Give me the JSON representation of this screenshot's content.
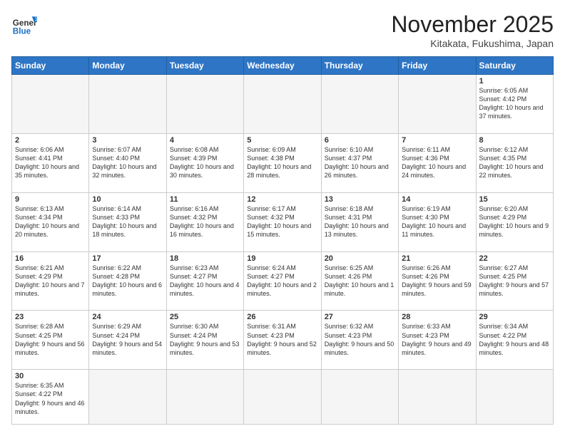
{
  "header": {
    "logo_general": "General",
    "logo_blue": "Blue",
    "month_title": "November 2025",
    "location": "Kitakata, Fukushima, Japan"
  },
  "weekdays": [
    "Sunday",
    "Monday",
    "Tuesday",
    "Wednesday",
    "Thursday",
    "Friday",
    "Saturday"
  ],
  "weeks": [
    [
      {
        "day": "",
        "empty": true
      },
      {
        "day": "",
        "empty": true
      },
      {
        "day": "",
        "empty": true
      },
      {
        "day": "",
        "empty": true
      },
      {
        "day": "",
        "empty": true
      },
      {
        "day": "",
        "empty": true
      },
      {
        "day": "1",
        "sunrise": "6:05 AM",
        "sunset": "4:42 PM",
        "daylight": "10 hours and 37 minutes."
      }
    ],
    [
      {
        "day": "2",
        "sunrise": "6:06 AM",
        "sunset": "4:41 PM",
        "daylight": "10 hours and 35 minutes."
      },
      {
        "day": "3",
        "sunrise": "6:07 AM",
        "sunset": "4:40 PM",
        "daylight": "10 hours and 32 minutes."
      },
      {
        "day": "4",
        "sunrise": "6:08 AM",
        "sunset": "4:39 PM",
        "daylight": "10 hours and 30 minutes."
      },
      {
        "day": "5",
        "sunrise": "6:09 AM",
        "sunset": "4:38 PM",
        "daylight": "10 hours and 28 minutes."
      },
      {
        "day": "6",
        "sunrise": "6:10 AM",
        "sunset": "4:37 PM",
        "daylight": "10 hours and 26 minutes."
      },
      {
        "day": "7",
        "sunrise": "6:11 AM",
        "sunset": "4:36 PM",
        "daylight": "10 hours and 24 minutes."
      },
      {
        "day": "8",
        "sunrise": "6:12 AM",
        "sunset": "4:35 PM",
        "daylight": "10 hours and 22 minutes."
      }
    ],
    [
      {
        "day": "9",
        "sunrise": "6:13 AM",
        "sunset": "4:34 PM",
        "daylight": "10 hours and 20 minutes."
      },
      {
        "day": "10",
        "sunrise": "6:14 AM",
        "sunset": "4:33 PM",
        "daylight": "10 hours and 18 minutes."
      },
      {
        "day": "11",
        "sunrise": "6:16 AM",
        "sunset": "4:32 PM",
        "daylight": "10 hours and 16 minutes."
      },
      {
        "day": "12",
        "sunrise": "6:17 AM",
        "sunset": "4:32 PM",
        "daylight": "10 hours and 15 minutes."
      },
      {
        "day": "13",
        "sunrise": "6:18 AM",
        "sunset": "4:31 PM",
        "daylight": "10 hours and 13 minutes."
      },
      {
        "day": "14",
        "sunrise": "6:19 AM",
        "sunset": "4:30 PM",
        "daylight": "10 hours and 11 minutes."
      },
      {
        "day": "15",
        "sunrise": "6:20 AM",
        "sunset": "4:29 PM",
        "daylight": "10 hours and 9 minutes."
      }
    ],
    [
      {
        "day": "16",
        "sunrise": "6:21 AM",
        "sunset": "4:29 PM",
        "daylight": "10 hours and 7 minutes."
      },
      {
        "day": "17",
        "sunrise": "6:22 AM",
        "sunset": "4:28 PM",
        "daylight": "10 hours and 6 minutes."
      },
      {
        "day": "18",
        "sunrise": "6:23 AM",
        "sunset": "4:27 PM",
        "daylight": "10 hours and 4 minutes."
      },
      {
        "day": "19",
        "sunrise": "6:24 AM",
        "sunset": "4:27 PM",
        "daylight": "10 hours and 2 minutes."
      },
      {
        "day": "20",
        "sunrise": "6:25 AM",
        "sunset": "4:26 PM",
        "daylight": "10 hours and 1 minute."
      },
      {
        "day": "21",
        "sunrise": "6:26 AM",
        "sunset": "4:26 PM",
        "daylight": "9 hours and 59 minutes."
      },
      {
        "day": "22",
        "sunrise": "6:27 AM",
        "sunset": "4:25 PM",
        "daylight": "9 hours and 57 minutes."
      }
    ],
    [
      {
        "day": "23",
        "sunrise": "6:28 AM",
        "sunset": "4:25 PM",
        "daylight": "9 hours and 56 minutes."
      },
      {
        "day": "24",
        "sunrise": "6:29 AM",
        "sunset": "4:24 PM",
        "daylight": "9 hours and 54 minutes."
      },
      {
        "day": "25",
        "sunrise": "6:30 AM",
        "sunset": "4:24 PM",
        "daylight": "9 hours and 53 minutes."
      },
      {
        "day": "26",
        "sunrise": "6:31 AM",
        "sunset": "4:23 PM",
        "daylight": "9 hours and 52 minutes."
      },
      {
        "day": "27",
        "sunrise": "6:32 AM",
        "sunset": "4:23 PM",
        "daylight": "9 hours and 50 minutes."
      },
      {
        "day": "28",
        "sunrise": "6:33 AM",
        "sunset": "4:23 PM",
        "daylight": "9 hours and 49 minutes."
      },
      {
        "day": "29",
        "sunrise": "6:34 AM",
        "sunset": "4:22 PM",
        "daylight": "9 hours and 48 minutes."
      }
    ],
    [
      {
        "day": "30",
        "sunrise": "6:35 AM",
        "sunset": "4:22 PM",
        "daylight": "9 hours and 46 minutes."
      },
      {
        "day": "",
        "empty": true
      },
      {
        "day": "",
        "empty": true
      },
      {
        "day": "",
        "empty": true
      },
      {
        "day": "",
        "empty": true
      },
      {
        "day": "",
        "empty": true
      },
      {
        "day": "",
        "empty": true
      }
    ]
  ]
}
